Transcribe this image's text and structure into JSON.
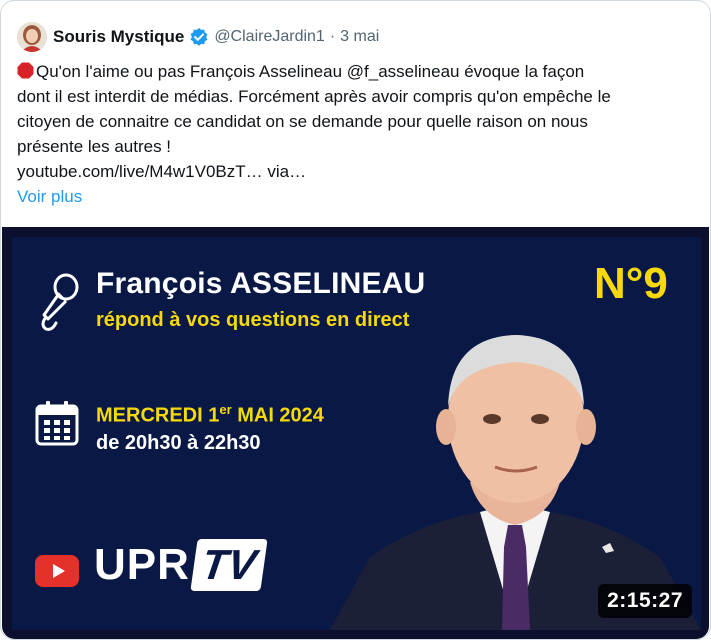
{
  "tweet": {
    "author_name": "Souris Mystique",
    "handle": "@ClaireJardin1",
    "separator": "·",
    "date": "3 mai",
    "lines": [
      "Qu'on l'aime ou pas François Asselineau @f_asselineau évoque la façon",
      "dont il est interdit de médias. Forcément après avoir compris qu'on empêche le",
      "citoyen de connaitre ce candidat on se demande pour quelle raison on nous",
      "présente les autres !",
      "youtube.com/live/M4w1V0BzT… via…"
    ],
    "show_more": "Voir plus"
  },
  "video": {
    "title": "François ASSELINEAU",
    "subtitle": "répond à vos questions en direct",
    "number": "N°9",
    "date_main": "MERCREDI 1",
    "date_sup": "er",
    "date_rest": " MAI 2024",
    "time": "de 20h30 à 22h30",
    "brand": "UPR",
    "brand_tv": "TV",
    "duration": "2:15:27"
  },
  "icons": {
    "verified": "verified-badge-icon",
    "stop": "stop-sign-emoji-icon",
    "mic": "microphone-icon",
    "calendar": "calendar-icon",
    "youtube": "youtube-play-icon"
  },
  "colors": {
    "banner_bg": "#091845",
    "accent_yellow": "#f6d90b",
    "link_blue": "#1d9bf0",
    "verified_blue": "#1d9bf0"
  }
}
